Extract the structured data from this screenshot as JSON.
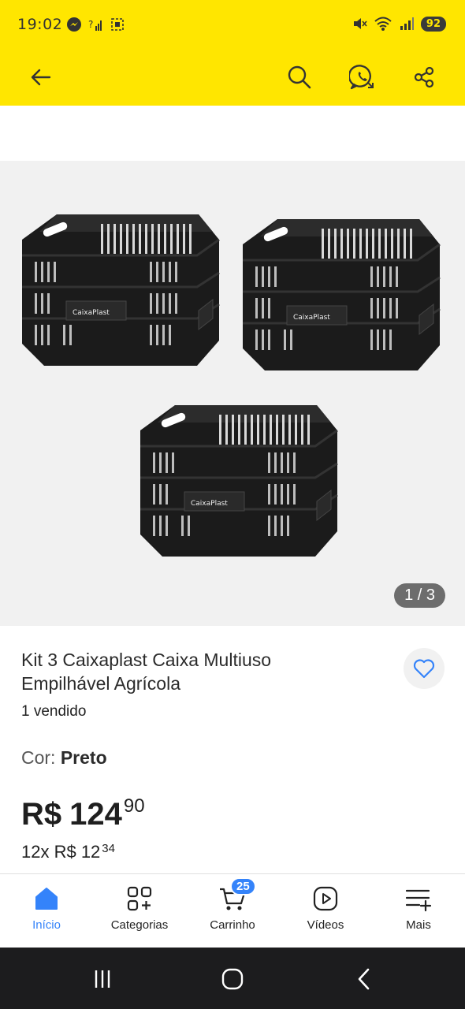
{
  "status_bar": {
    "time": "19:02",
    "battery": "92"
  },
  "header": {
    "icons": [
      "back-arrow-icon",
      "search-icon",
      "whatsapp-icon",
      "share-icon"
    ],
    "background": "#ffe600"
  },
  "gallery": {
    "counter": "1 / 3",
    "brand_label": "CaixaPlast"
  },
  "product": {
    "title": "Kit 3 Caixaplast Caixa Multiuso Empilhável Agrícola",
    "sold": "1 vendido",
    "color_label": "Cor:",
    "color_value": "Preto",
    "price_currency": "R$",
    "price_integer": "124",
    "price_cents": "90",
    "installments_prefix": "12x R$ 12",
    "installments_cents": "34"
  },
  "bottom_nav": {
    "items": [
      {
        "label": "Início",
        "icon": "home-icon",
        "active": true
      },
      {
        "label": "Categorias",
        "icon": "categories-icon",
        "active": false
      },
      {
        "label": "Carrinho",
        "icon": "cart-icon",
        "active": false
      },
      {
        "label": "Vídeos",
        "icon": "video-play-icon",
        "active": false
      },
      {
        "label": "Mais",
        "icon": "more-list-icon",
        "active": false
      }
    ],
    "cart_count": "25",
    "accent_color": "#3483fa"
  }
}
